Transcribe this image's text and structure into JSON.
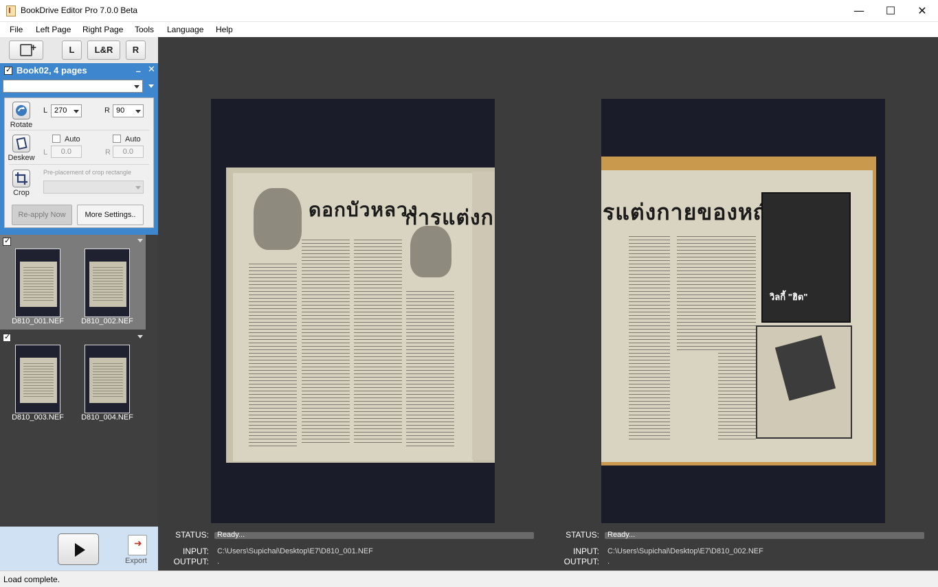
{
  "window": {
    "title": "BookDrive Editor Pro 7.0.0 Beta",
    "minimize": "—",
    "maximize": "☐",
    "close": "✕"
  },
  "menu": [
    "File",
    "Left Page",
    "Right Page",
    "Tools",
    "Language",
    "Help"
  ],
  "toolbar": {
    "left": "L",
    "both": "L&R",
    "right": "R"
  },
  "book": {
    "title": "Book02, 4 pages",
    "checked": true,
    "minimize": "_",
    "close": "✕",
    "rotate": {
      "label": "Rotate",
      "l_label": "L",
      "l_value": "270",
      "r_label": "R",
      "r_value": "90"
    },
    "deskew": {
      "label": "Deskew",
      "auto_label": "Auto",
      "l_label": "L",
      "l_value": "0.0",
      "r_label": "R",
      "r_value": "0.0"
    },
    "crop": {
      "label": "Crop",
      "placement_label": "Pre-placement of crop rectangle"
    },
    "reapply_label": "Re-apply Now",
    "more_settings_label": "More Settings.."
  },
  "thumbnails": [
    {
      "pages": [
        {
          "name": "D810_001.NEF"
        },
        {
          "name": "D810_002.NEF"
        }
      ],
      "selected": true
    },
    {
      "pages": [
        {
          "name": "D810_003.NEF"
        },
        {
          "name": "D810_004.NEF"
        }
      ],
      "selected": false
    }
  ],
  "export_label": "Export",
  "left_view": {
    "headline": "ดอกบัวหลวง",
    "headline2": "การแต่งกาย",
    "status_label": "STATUS:",
    "status": "Ready...",
    "input_label": "INPUT:",
    "input": "C:\\Users\\Supichai\\Desktop\\E7\\D810_001.NEF",
    "output_label": "OUTPUT:",
    "output": "."
  },
  "right_view": {
    "headline": "รแต่งกายของหญิง",
    "ad_text": "วิลกี้ \"ฮิต\"",
    "status_label": "STATUS:",
    "status": "Ready...",
    "input_label": "INPUT:",
    "input": "C:\\Users\\Supichai\\Desktop\\E7\\D810_002.NEF",
    "output_label": "OUTPUT:",
    "output": "."
  },
  "statusbar": "Load complete.",
  "colors": {
    "panel_accent": "#3e86cd",
    "background": "#3c3c3c",
    "bottom_panel": "#cfe1f2"
  }
}
